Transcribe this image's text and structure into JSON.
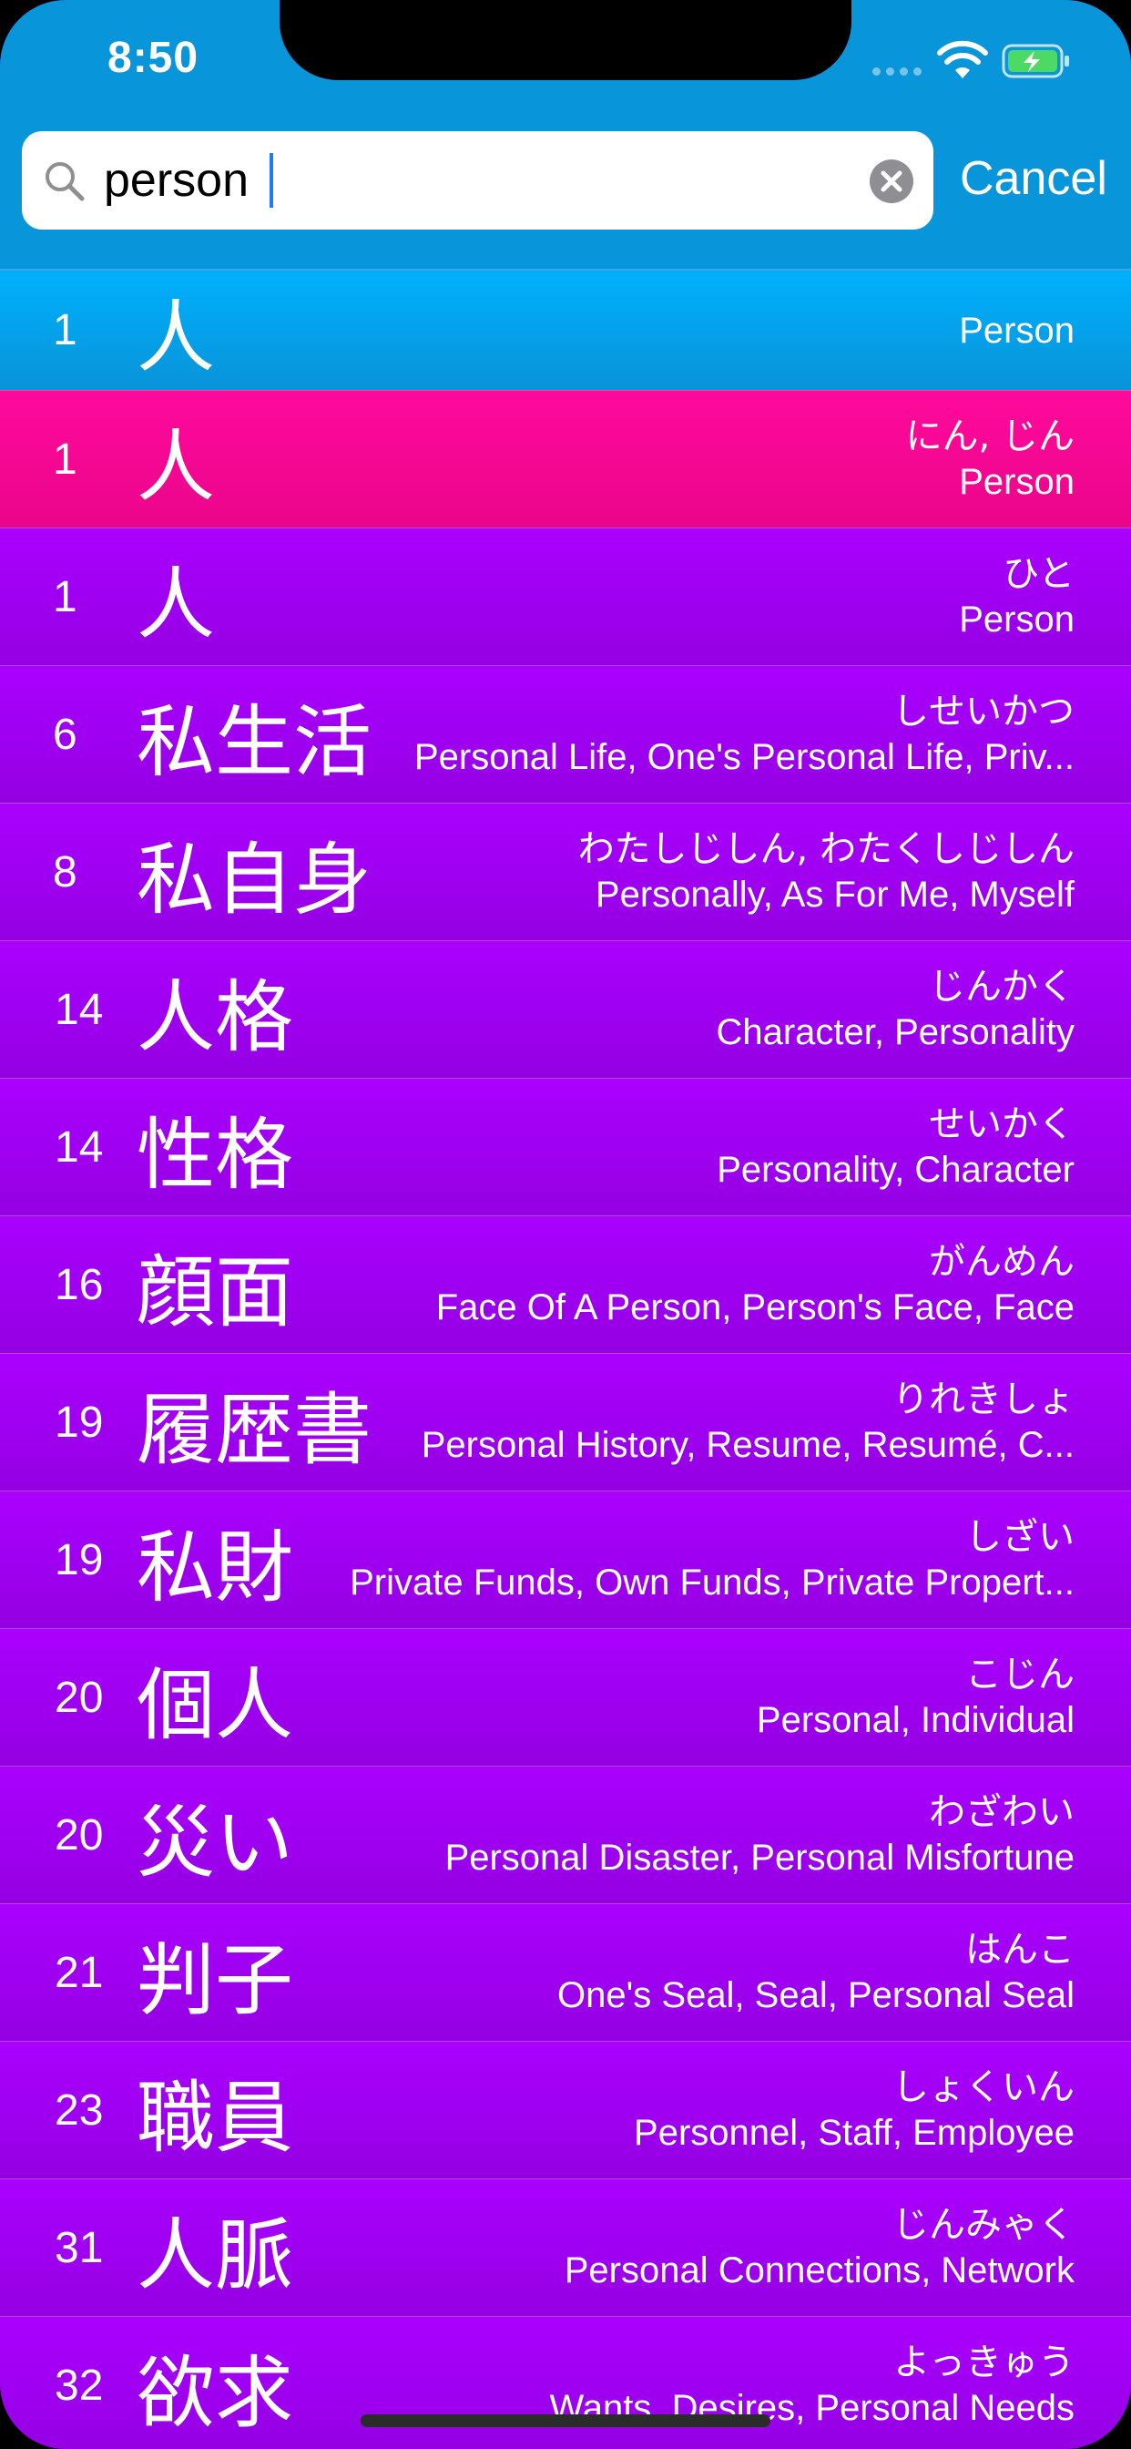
{
  "status_bar": {
    "time": "8:50"
  },
  "search": {
    "value": "person",
    "cancel_label": "Cancel"
  },
  "results": [
    {
      "level": "1",
      "kanji": "人",
      "reading": "",
      "meaning": "Person"
    },
    {
      "level": "1",
      "kanji": "人",
      "reading": "にん, じん",
      "meaning": "Person"
    },
    {
      "level": "1",
      "kanji": "人",
      "reading": "ひと",
      "meaning": "Person"
    },
    {
      "level": "6",
      "kanji": "私生活",
      "reading": "しせいかつ",
      "meaning": "Personal Life, One's Personal Life, Priv..."
    },
    {
      "level": "8",
      "kanji": "私自身",
      "reading": "わたしじしん, わたくしじしん",
      "meaning": "Personally, As For Me, Myself"
    },
    {
      "level": "14",
      "kanji": "人格",
      "reading": "じんかく",
      "meaning": "Character, Personality"
    },
    {
      "level": "14",
      "kanji": "性格",
      "reading": "せいかく",
      "meaning": "Personality, Character"
    },
    {
      "level": "16",
      "kanji": "顔面",
      "reading": "がんめん",
      "meaning": "Face Of A Person, Person's Face, Face"
    },
    {
      "level": "19",
      "kanji": "履歴書",
      "reading": "りれきしょ",
      "meaning": "Personal History, Resume, Resumé, C..."
    },
    {
      "level": "19",
      "kanji": "私財",
      "reading": "しざい",
      "meaning": "Private Funds, Own Funds, Private Propert..."
    },
    {
      "level": "20",
      "kanji": "個人",
      "reading": "こじん",
      "meaning": "Personal, Individual"
    },
    {
      "level": "20",
      "kanji": "災い",
      "reading": "わざわい",
      "meaning": "Personal Disaster, Personal Misfortune"
    },
    {
      "level": "21",
      "kanji": "判子",
      "reading": "はんこ",
      "meaning": "One's Seal, Seal, Personal Seal"
    },
    {
      "level": "23",
      "kanji": "職員",
      "reading": "しょくいん",
      "meaning": "Personnel, Staff, Employee"
    },
    {
      "level": "31",
      "kanji": "人脈",
      "reading": "じんみゃく",
      "meaning": "Personal Connections, Network"
    },
    {
      "level": "32",
      "kanji": "欲求",
      "reading": "よっきゅう",
      "meaning": "Wants, Desires, Personal Needs"
    }
  ],
  "colors": {
    "header": "#0995da",
    "first_row": "#00b0fd",
    "second_row": "#ff0a9c",
    "row": "#a200ee"
  }
}
